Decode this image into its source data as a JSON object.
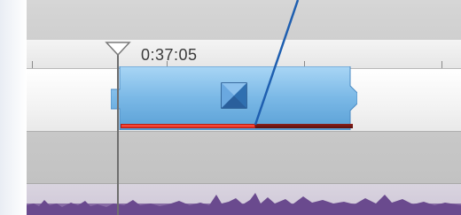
{
  "playhead": {
    "timecode": "0:37:05"
  },
  "clip": {
    "transition_icon": "transition-icon",
    "progress_fraction": 0.58
  },
  "colors": {
    "clip_blue": "#7ab8e6",
    "progress_red": "#e0271a",
    "progress_remaining": "#6a1412",
    "callout_blue": "#1f5fb0",
    "waveform": "#7a5a9a"
  },
  "icons": [
    "playhead-marker-icon",
    "transition-icon"
  ]
}
